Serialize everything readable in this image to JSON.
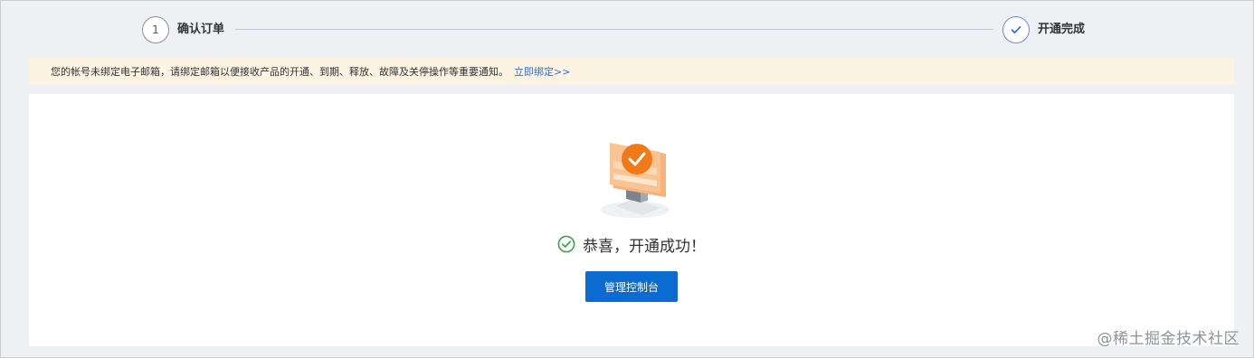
{
  "steps": [
    {
      "number": "1",
      "label": "确认订单",
      "state": "done"
    },
    {
      "label": "开通完成",
      "state": "current",
      "icon": "check-icon"
    }
  ],
  "notice": {
    "text": "您的帐号未绑定电子邮箱，请绑定邮箱以便接收产品的开通、到期、释放、故障及关停操作等重要通知。",
    "link": "立即绑定>>"
  },
  "result": {
    "icon": "success-check-circle-icon",
    "message": "恭喜，开通成功！",
    "button": "管理控制台"
  },
  "watermark": "@稀土掘金技术社区",
  "colors": {
    "primary": "#0c6bd0",
    "link": "#2f6fd6",
    "success": "#3aa24a",
    "accent": "#f07a1a",
    "notice_bg": "#fdf3e3",
    "page_bg": "#eef0f3"
  }
}
